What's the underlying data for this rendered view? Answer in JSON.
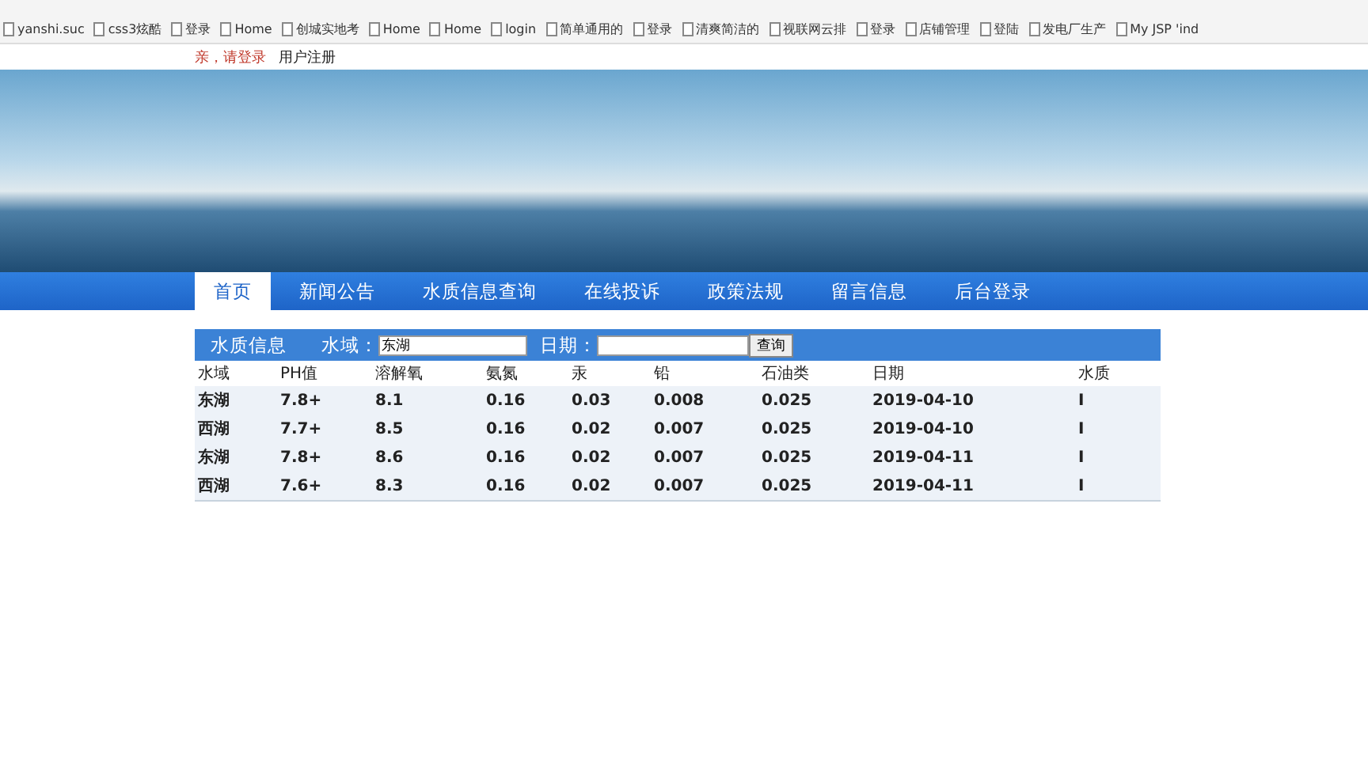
{
  "browser": {
    "bookmarks": [
      "yanshi.suc",
      "css3炫酷",
      "登录",
      "Home",
      "创城实地考",
      "Home",
      "Home",
      "login",
      "简单通用的",
      "登录",
      "清爽简洁的",
      "视联网云排",
      "登录",
      "店铺管理",
      "登陆",
      "发电厂生产",
      "My JSP 'ind"
    ]
  },
  "top_links": [
    {
      "label": "亲，请登录",
      "kind": "alert"
    },
    {
      "label": "用户注册",
      "kind": "plain"
    }
  ],
  "nav": [
    {
      "label": "首页",
      "selected": true
    },
    {
      "label": "新闻公告",
      "selected": false
    },
    {
      "label": "水质信息查询",
      "selected": false
    },
    {
      "label": "在线投诉",
      "selected": false
    },
    {
      "label": "政策法规",
      "selected": false
    },
    {
      "label": "留言信息",
      "selected": false
    },
    {
      "label": "后台登录",
      "selected": false
    }
  ],
  "search": {
    "title": "水质信息",
    "water_label": "水域：",
    "water_value": "东湖",
    "date_label": "日期：",
    "button": "查询"
  },
  "table": {
    "columns": [
      "水域",
      "PH值",
      "溶解氧",
      "氨氮",
      "汞",
      "铅",
      "石油类",
      "日期",
      "水质"
    ],
    "rows": [
      [
        "东湖",
        "7.8+",
        "8.1",
        "0.16",
        "0.03",
        "0.008",
        "0.025",
        "2019-04-10",
        "I"
      ],
      [
        "西湖",
        "7.7+",
        "8.5",
        "0.16",
        "0.02",
        "0.007",
        "0.025",
        "2019-04-10",
        "I"
      ],
      [
        "东湖",
        "7.8+",
        "8.6",
        "0.16",
        "0.02",
        "0.007",
        "0.025",
        "2019-04-11",
        "I"
      ],
      [
        "西湖",
        "7.6+",
        "8.3",
        "0.16",
        "0.02",
        "0.007",
        "0.025",
        "2019-04-11",
        "I"
      ]
    ]
  }
}
